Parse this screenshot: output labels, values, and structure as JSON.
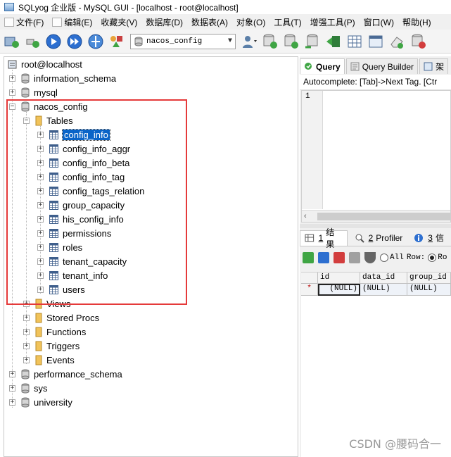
{
  "window": {
    "title": "SQLyog 企业版 - MySQL GUI - [localhost - root@localhost]"
  },
  "menu": [
    "文件(F)",
    "编辑(E)",
    "收藏夹(V)",
    "数据库(D)",
    "数据表(A)",
    "对象(O)",
    "工具(T)",
    "增强工具(P)",
    "窗口(W)",
    "帮助(H)"
  ],
  "toolbar": {
    "database_select": "nacos_config"
  },
  "tree": {
    "root": "root@localhost",
    "databases": {
      "information_schema": "information_schema",
      "mysql": "mysql",
      "nacos_config": "nacos_config",
      "performance_schema": "performance_schema",
      "sys": "sys",
      "university": "university"
    },
    "folders": {
      "tables": "Tables",
      "views": "Views",
      "stored_procs": "Stored Procs",
      "functions": "Functions",
      "triggers": "Triggers",
      "events": "Events"
    },
    "tables": [
      "config_info",
      "config_info_aggr",
      "config_info_beta",
      "config_info_tag",
      "config_tags_relation",
      "group_capacity",
      "his_config_info",
      "permissions",
      "roles",
      "tenant_capacity",
      "tenant_info",
      "users"
    ],
    "selected_table": "config_info"
  },
  "query_tabs": {
    "query": "Query",
    "builder": "Query Builder",
    "third": "架"
  },
  "autocomplete": "Autocomplete: [Tab]->Next Tag. [Ctr",
  "editor": {
    "line_numbers": [
      "1"
    ]
  },
  "result_tabs": [
    {
      "num": "1",
      "label": "结果"
    },
    {
      "num": "2",
      "label": "Profiler"
    },
    {
      "num": "3",
      "label": "信"
    }
  ],
  "result_toolbar": {
    "all_label": "All",
    "row_label": "Row:",
    "row_value": "Ro"
  },
  "grid": {
    "columns": [
      "id",
      "data_id",
      "group_id"
    ],
    "marker": "*",
    "row": [
      "(NULL)",
      "(NULL)",
      "(NULL)"
    ]
  },
  "watermark": "CSDN @腰码合一",
  "colors": {
    "selection": "#0a64c8",
    "highlight_box": "#e53a3a"
  }
}
